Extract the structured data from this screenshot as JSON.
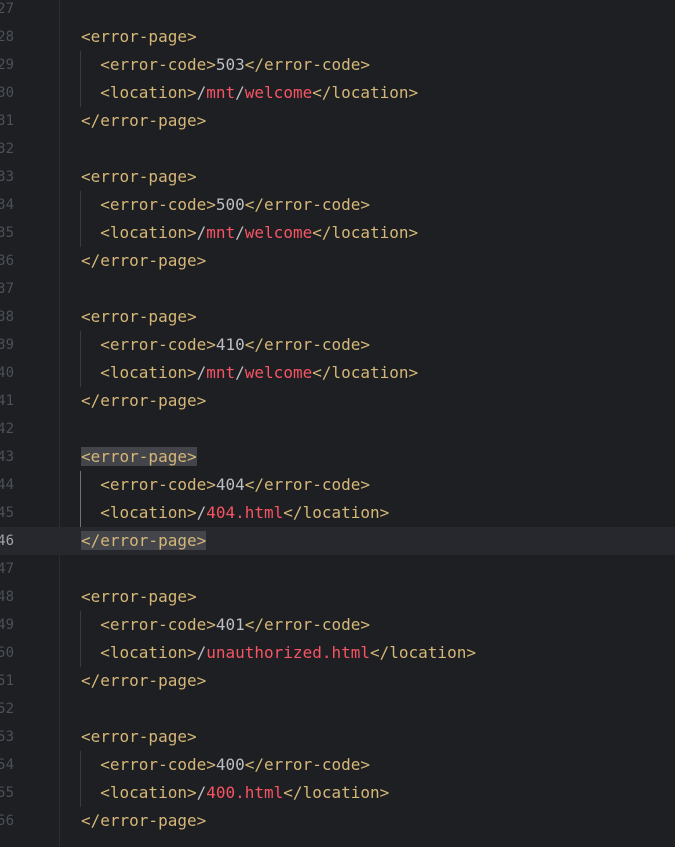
{
  "editor": {
    "lines": [
      {
        "num": "27",
        "parts": []
      },
      {
        "num": "28",
        "parts": [
          {
            "t": "tag",
            "v": "<error-page>"
          }
        ]
      },
      {
        "num": "29",
        "parts": [
          {
            "t": "sp",
            "v": "  "
          },
          {
            "t": "tag",
            "v": "<error-code>"
          },
          {
            "t": "txt",
            "v": "503"
          },
          {
            "t": "tag",
            "v": "</error-code>"
          }
        ]
      },
      {
        "num": "30",
        "parts": [
          {
            "t": "sp",
            "v": "  "
          },
          {
            "t": "tag",
            "v": "<location>"
          },
          {
            "t": "txt",
            "v": "/"
          },
          {
            "t": "path",
            "v": "mnt"
          },
          {
            "t": "txt",
            "v": "/"
          },
          {
            "t": "path",
            "v": "welcome"
          },
          {
            "t": "tag",
            "v": "</location>"
          }
        ]
      },
      {
        "num": "31",
        "parts": [
          {
            "t": "tag",
            "v": "</error-page>"
          }
        ]
      },
      {
        "num": "32",
        "parts": []
      },
      {
        "num": "33",
        "parts": [
          {
            "t": "tag",
            "v": "<error-page>"
          }
        ]
      },
      {
        "num": "34",
        "parts": [
          {
            "t": "sp",
            "v": "  "
          },
          {
            "t": "tag",
            "v": "<error-code>"
          },
          {
            "t": "txt",
            "v": "500"
          },
          {
            "t": "tag",
            "v": "</error-code>"
          }
        ]
      },
      {
        "num": "35",
        "parts": [
          {
            "t": "sp",
            "v": "  "
          },
          {
            "t": "tag",
            "v": "<location>"
          },
          {
            "t": "txt",
            "v": "/"
          },
          {
            "t": "path",
            "v": "mnt"
          },
          {
            "t": "txt",
            "v": "/"
          },
          {
            "t": "path",
            "v": "welcome"
          },
          {
            "t": "tag",
            "v": "</location>"
          }
        ]
      },
      {
        "num": "36",
        "parts": [
          {
            "t": "tag",
            "v": "</error-page>"
          }
        ]
      },
      {
        "num": "37",
        "parts": []
      },
      {
        "num": "38",
        "parts": [
          {
            "t": "tag",
            "v": "<error-page>"
          }
        ]
      },
      {
        "num": "39",
        "parts": [
          {
            "t": "sp",
            "v": "  "
          },
          {
            "t": "tag",
            "v": "<error-code>"
          },
          {
            "t": "txt",
            "v": "410"
          },
          {
            "t": "tag",
            "v": "</error-code>"
          }
        ]
      },
      {
        "num": "40",
        "parts": [
          {
            "t": "sp",
            "v": "  "
          },
          {
            "t": "tag",
            "v": "<location>"
          },
          {
            "t": "txt",
            "v": "/"
          },
          {
            "t": "path",
            "v": "mnt"
          },
          {
            "t": "txt",
            "v": "/"
          },
          {
            "t": "path",
            "v": "welcome"
          },
          {
            "t": "tag",
            "v": "</location>"
          }
        ]
      },
      {
        "num": "41",
        "parts": [
          {
            "t": "tag",
            "v": "</error-page>"
          }
        ]
      },
      {
        "num": "42",
        "parts": []
      },
      {
        "num": "43",
        "parts": [
          {
            "t": "tag",
            "v": "<error-page>",
            "hl": true
          }
        ]
      },
      {
        "num": "44",
        "parts": [
          {
            "t": "sp",
            "v": "  "
          },
          {
            "t": "tag",
            "v": "<error-code>"
          },
          {
            "t": "txt",
            "v": "404"
          },
          {
            "t": "tag",
            "v": "</error-code>"
          }
        ]
      },
      {
        "num": "45",
        "parts": [
          {
            "t": "sp",
            "v": "  "
          },
          {
            "t": "tag",
            "v": "<location>"
          },
          {
            "t": "txt",
            "v": "/"
          },
          {
            "t": "path",
            "v": "404.html"
          },
          {
            "t": "tag",
            "v": "</location>"
          }
        ]
      },
      {
        "num": "46",
        "current": true,
        "parts": [
          {
            "t": "tag",
            "v": "</error-page>",
            "hl": true
          }
        ]
      },
      {
        "num": "47",
        "parts": []
      },
      {
        "num": "48",
        "parts": [
          {
            "t": "tag",
            "v": "<error-page>"
          }
        ]
      },
      {
        "num": "49",
        "parts": [
          {
            "t": "sp",
            "v": "  "
          },
          {
            "t": "tag",
            "v": "<error-code>"
          },
          {
            "t": "txt",
            "v": "401"
          },
          {
            "t": "tag",
            "v": "</error-code>"
          }
        ]
      },
      {
        "num": "50",
        "parts": [
          {
            "t": "sp",
            "v": "  "
          },
          {
            "t": "tag",
            "v": "<location>"
          },
          {
            "t": "txt",
            "v": "/"
          },
          {
            "t": "path",
            "v": "unauthorized.html"
          },
          {
            "t": "tag",
            "v": "</location>"
          }
        ]
      },
      {
        "num": "51",
        "parts": [
          {
            "t": "tag",
            "v": "</error-page>"
          }
        ]
      },
      {
        "num": "52",
        "parts": []
      },
      {
        "num": "53",
        "parts": [
          {
            "t": "tag",
            "v": "<error-page>"
          }
        ]
      },
      {
        "num": "54",
        "parts": [
          {
            "t": "sp",
            "v": "  "
          },
          {
            "t": "tag",
            "v": "<error-code>"
          },
          {
            "t": "txt",
            "v": "400"
          },
          {
            "t": "tag",
            "v": "</error-code>"
          }
        ]
      },
      {
        "num": "55",
        "parts": [
          {
            "t": "sp",
            "v": "  "
          },
          {
            "t": "tag",
            "v": "<location>"
          },
          {
            "t": "txt",
            "v": "/"
          },
          {
            "t": "path",
            "v": "400.html"
          },
          {
            "t": "tag",
            "v": "</location>"
          }
        ]
      },
      {
        "num": "56",
        "parts": [
          {
            "t": "tag",
            "v": "</error-page>"
          }
        ]
      }
    ],
    "colors": {
      "background": "#1e1f22",
      "tag": "#d5b778",
      "text": "#bcbec4",
      "path": "#f75464",
      "current_line": "#26282e",
      "match_highlight": "#43454a"
    }
  }
}
